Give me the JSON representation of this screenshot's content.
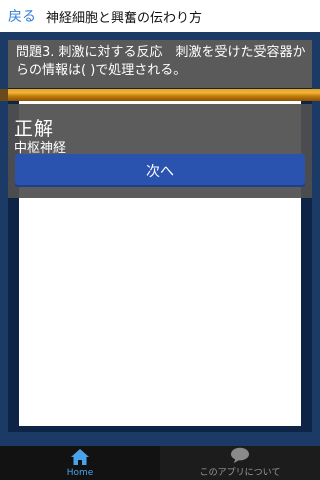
{
  "header": {
    "back_label": "戻る",
    "title": "神経細胞と興奮の伝わり方"
  },
  "question": {
    "text": "問題3. 刺激に対する反応　刺激を受けた受容器からの情報は( )で処理される。"
  },
  "result": {
    "title": "正解",
    "answer": "中枢神経",
    "next_label": "次へ"
  },
  "tabs": [
    {
      "label": "Home",
      "icon": "home-icon",
      "active": true
    },
    {
      "label": "このアプリについて",
      "icon": "chat-bubble-icon",
      "active": false
    }
  ],
  "colors": {
    "accent": "#2f7fd6",
    "next_button": "#2a53b0",
    "orange_bar": "#e9a21c",
    "tab_active": "#4aa3e8"
  }
}
